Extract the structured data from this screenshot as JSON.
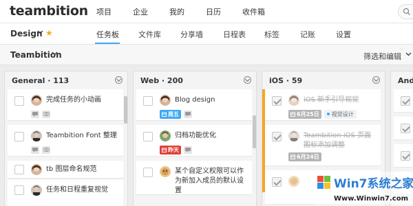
{
  "brand": "teambition",
  "top_nav": [
    "项目",
    "企业",
    "我的",
    "日历",
    "收件箱"
  ],
  "project": {
    "name": "Design",
    "starred": true
  },
  "tabs": [
    "任务板",
    "文件库",
    "分享墙",
    "日程表",
    "标签",
    "记账",
    "设置"
  ],
  "active_tab": "任务板",
  "group": "Teambition",
  "filter_label": "筛选和编辑",
  "columns": [
    {
      "title": "General · 113",
      "tasks": [
        {
          "title": "完成任务的小动画",
          "done": false,
          "has_comment": true,
          "has_link": true
        },
        {
          "title": "Teambition Font 整理",
          "done": false,
          "has_comment": true,
          "has_link": true
        },
        {
          "title": "tb 图层命名规范",
          "done": false
        },
        {
          "title": "任务和日程重复视觉",
          "done": false
        }
      ]
    },
    {
      "title": "Web · 200",
      "tasks": [
        {
          "title": "Blog design",
          "done": false,
          "date": "周五",
          "date_color": "blue",
          "has_comment": true
        },
        {
          "title": "归档功能优化",
          "done": false,
          "date": "昨天",
          "date_color": "red",
          "has_comment": true
        },
        {
          "title": "某个自定义权限可以作为新加入成员的默认设置",
          "done": false
        }
      ]
    },
    {
      "title": "iOS · 59",
      "tasks": [
        {
          "title": "iOS 新手引导视觉",
          "done": true,
          "date": "6月25日",
          "date_color": "gray",
          "tag": "视觉设计"
        },
        {
          "title": "Teambition iOS 页面图标添加调整",
          "done": true,
          "date": "6月24日",
          "date_color": "gray"
        },
        {
          "title": "",
          "done": true
        }
      ]
    },
    {
      "title": "Andr",
      "tasks": [
        {
          "done": true
        },
        {
          "done": true
        },
        {
          "done": true
        },
        {
          "done": true
        }
      ]
    }
  ],
  "watermark": {
    "brand": "Win7系统之家",
    "url": "Www.Winwin7.com"
  },
  "colors": {
    "accent": "#3da8f5",
    "star": "#f5a623",
    "overdue": "#e0403a",
    "ios_bar": "#f5a623"
  }
}
